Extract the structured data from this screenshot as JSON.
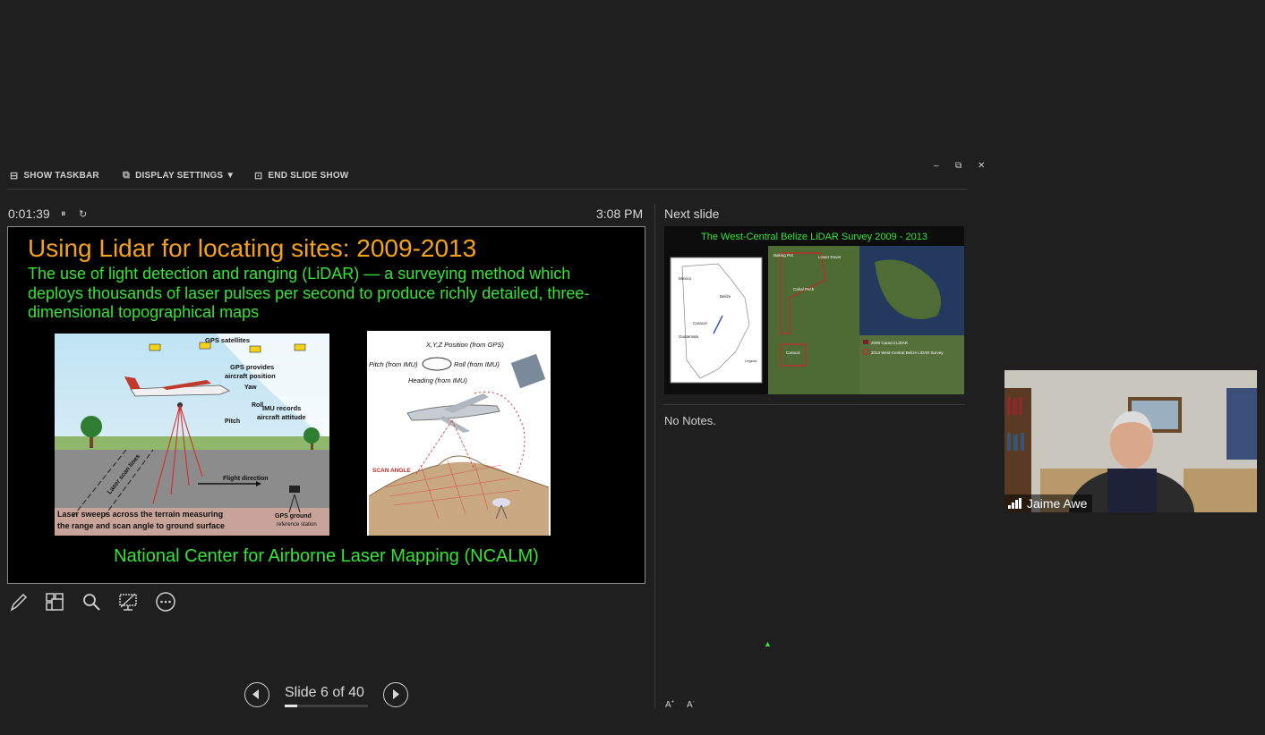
{
  "toolbar": {
    "show_taskbar": "SHOW TASKBAR",
    "display_settings": "DISPLAY SETTINGS ▼",
    "end_slide_show": "END SLIDE SHOW"
  },
  "presenter": {
    "timer": "0:01:39",
    "clock": "3:08 PM",
    "next_slide_label": "Next slide",
    "notes": "No Notes.",
    "slide_counter": "Slide 6 of 40",
    "progress_fraction": 0.15
  },
  "slide": {
    "title": "Using Lidar for locating sites: 2009-2013",
    "body": "The use of light detection and ranging (LiDAR) — a surveying method which deploys thousands of laser pulses per second to produce richly detailed, three-dimensional topographical maps",
    "footer": "National Center for Airborne Laser Mapping (NCALM)",
    "figure1": {
      "gps_satellites": "GPS satellites",
      "gps_provides": "GPS provides",
      "aircraft_position": "aircraft position",
      "yaw": "Yaw",
      "roll": "Roll",
      "pitch": "Pitch",
      "imu_records": "IMU records",
      "aircraft_attitude": "aircraft attitude",
      "laser_scan_lines": "Laser scan lines",
      "flight_direction": "Flight direction",
      "caption1": "Laser sweeps across the terrain measuring",
      "caption2": "the range and scan angle to ground surface",
      "gps_ground": "GPS ground",
      "reference_station": "reference station"
    },
    "figure2": {
      "xyz": "X,Y,Z Position (from GPS)",
      "pitch": "Pitch (from IMU)",
      "roll": "Roll (from IMU)",
      "heading": "Heading (from IMU)",
      "scan_angle": "SCAN ANGLE"
    }
  },
  "next_slide": {
    "title": "The West-Central Belize LiDAR Survey 2009 - 2013",
    "labels": [
      "Mexico",
      "Belize",
      "Guatemala",
      "Caracol",
      "Baking Pot",
      "Lower Dover",
      "Cahal Pech",
      "Caracol",
      "2009 Caracol LiDAR",
      "2013 West-Central Belize LiDAR Survey",
      "Legend"
    ]
  },
  "participant": {
    "name": "Jaime Awe"
  },
  "colors": {
    "title_orange": "#f4a21c",
    "text_green": "#36e436",
    "background": "#1f1f1f"
  }
}
